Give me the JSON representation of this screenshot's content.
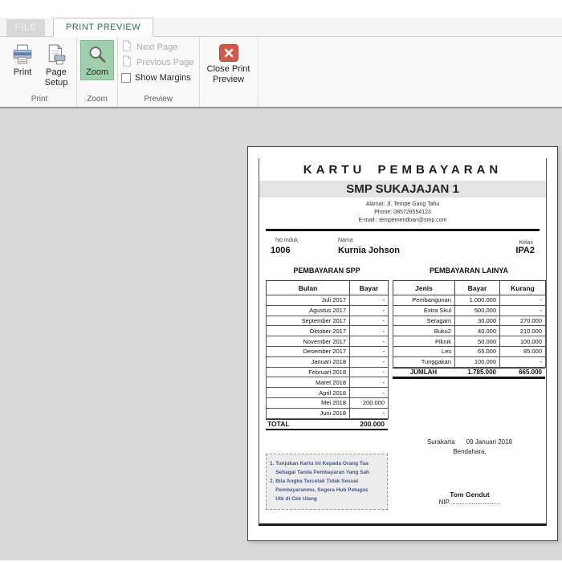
{
  "colors": {
    "accent_green": "#9fd0ad",
    "tab_active_text": "#2e6e57",
    "close_red": "#cd5a4a",
    "preview_bg": "#d9d9d9"
  },
  "ribbon": {
    "tabs": {
      "file": "FILE",
      "print_preview": "PRINT PREVIEW"
    },
    "print_group": {
      "label": "Print",
      "print": "Print",
      "page_setup": "Page Setup"
    },
    "zoom_group": {
      "label": "Zoom",
      "zoom": "Zoom"
    },
    "preview_group": {
      "label": "Preview",
      "next_page": "Next Page",
      "previous_page": "Previous Page",
      "show_margins": "Show Margins"
    },
    "close_group": {
      "close": "Close Print Preview"
    }
  },
  "document": {
    "title": "KARTU PEMBAYARAN",
    "school": "SMP SUKAJAJAN 1",
    "address": "Alamat: Jl. Tempe Gang Tahu",
    "phone": "Phone: 085728554123",
    "email": "E-mail : tempemendoan@smp.com",
    "student": {
      "no_induk_label": "No Induk",
      "no_induk": "1006",
      "nama_label": "Nama",
      "nama": "Kurnia Johson",
      "kelas_label": "Kelas",
      "kelas": "IPA2"
    },
    "spp": {
      "section": "PEMBAYARAN SPP",
      "headers": [
        "Bulan",
        "Bayar"
      ],
      "rows": [
        [
          "Juli 2017",
          "-"
        ],
        [
          "Agustus 2017",
          "-"
        ],
        [
          "September 2017",
          "-"
        ],
        [
          "Oktober 2017",
          "-"
        ],
        [
          "November 2017",
          "-"
        ],
        [
          "Desember 2017",
          "-"
        ],
        [
          "Januari 2018",
          "-"
        ],
        [
          "Februari 2018",
          "-"
        ],
        [
          "Maret 2018",
          "-"
        ],
        [
          "April 2018",
          "-"
        ],
        [
          "Mei 2018",
          "200.000"
        ],
        [
          "Juni 2018",
          "-"
        ]
      ],
      "total_label": "TOTAL",
      "total_value": "200.000"
    },
    "lainya": {
      "section": "PEMBAYARAN LAINYA",
      "headers": [
        "Jenis",
        "Bayar",
        "Kurang"
      ],
      "rows": [
        [
          "Pembangunan",
          "1.000.000",
          "-"
        ],
        [
          "Extra Skul",
          "500.000",
          "-"
        ],
        [
          "Seragam",
          "30.000",
          "270.000"
        ],
        [
          "Buku2",
          "40.000",
          "210.000"
        ],
        [
          "Piknik",
          "50.000",
          "100.000"
        ],
        [
          "Les",
          "65.000",
          "85.000"
        ],
        [
          "Tunggakan",
          "100.000",
          "-"
        ]
      ],
      "jumlah": [
        "JUMLAH",
        "1.785.000",
        "665.000"
      ]
    },
    "notes": {
      "lines": [
        "1. Tunjukan Kartu Ini Kepada Orang Tua",
        "    Sebagai Tanda Pembayaran Yang Sah",
        "2. Bila Angka Tercetak Tidak Sesuai",
        "    Pembayaranmu, Segera Hub Petugas",
        "    Utk di Cek Ulang"
      ]
    },
    "signature": {
      "city": "Surakarta",
      "date": "09 Januari 2018",
      "role": "Bendahara,",
      "name": "Tom Gendut",
      "nip": "NIP. ..........................."
    }
  }
}
